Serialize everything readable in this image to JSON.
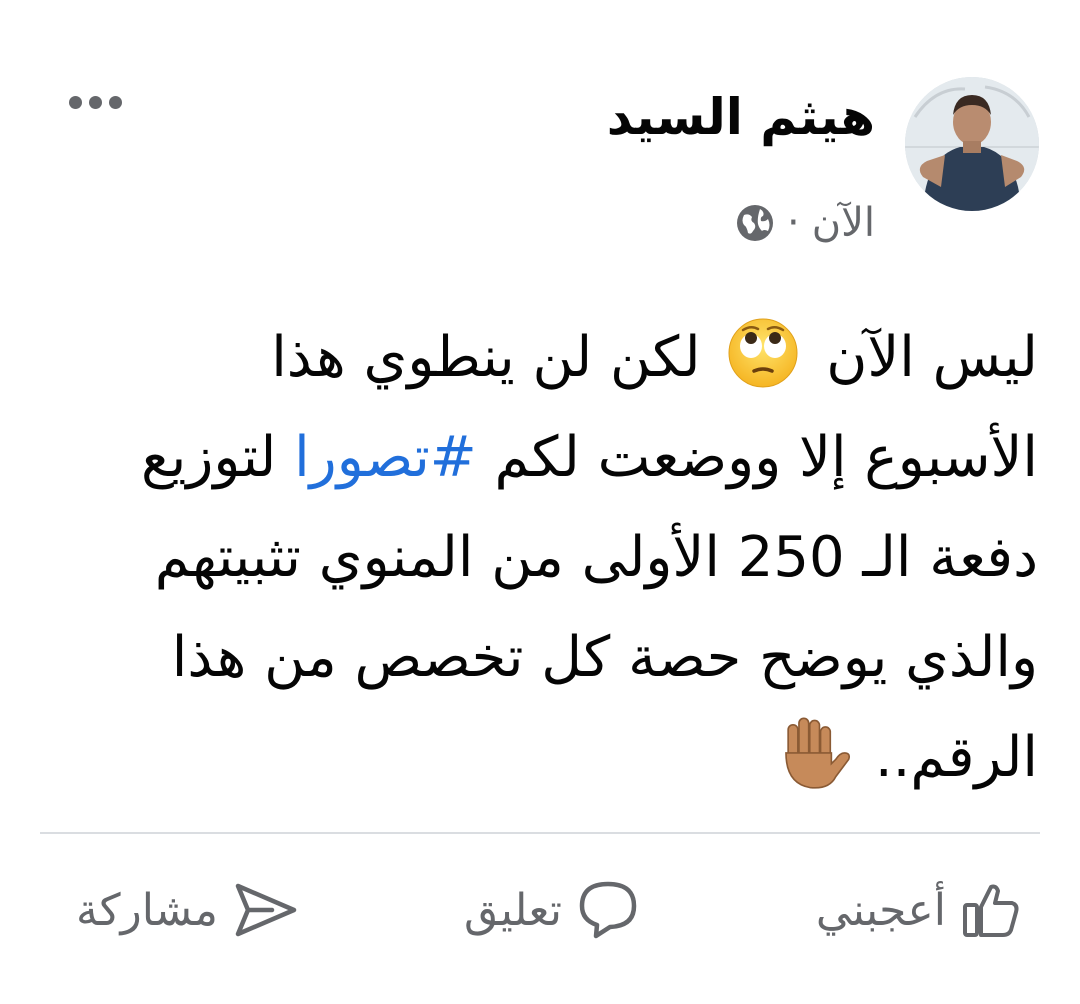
{
  "post": {
    "author": "هيثم السيد",
    "time": "الآن",
    "separator": "·",
    "privacy_icon": "globe-icon",
    "more_icon": "more-dots-icon",
    "text_lines": {
      "l1a": "ليس الآن",
      "l1b": "لكن لن ينطوي هذا",
      "l2a": "الأسبوع إلا ووضعت لكم",
      "l2tag": "#تصورا",
      "l2b": "لتوزيع",
      "l3": "دفعة الـ 250 الأولى من المنوي تثبيتهم",
      "l4": "والذي يوضح حصة كل تخصص من هذا",
      "l5": "الرقم.."
    },
    "emojis": [
      "face-with-rolling-eyes-emoji",
      "raised-hand-emoji"
    ]
  },
  "actions": {
    "like_label": "أعجبني",
    "comment_label": "تعليق",
    "share_label": "مشاركة"
  },
  "colors": {
    "text": "#050505",
    "secondary": "#65676b",
    "hashtag": "#216fdb",
    "divider": "#dadde1"
  }
}
